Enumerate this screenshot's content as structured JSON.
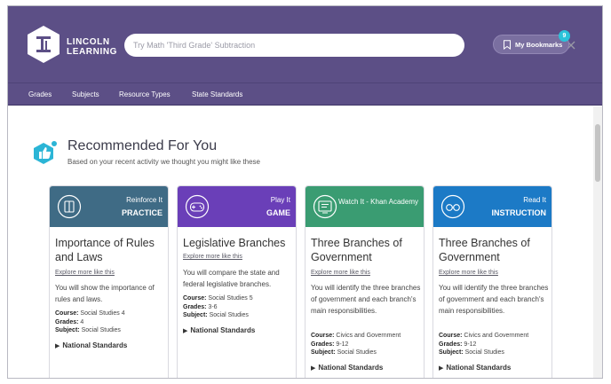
{
  "header": {
    "logo_line1": "LINCOLN",
    "logo_line2": "LEARNING",
    "search_placeholder": "Try Math 'Third Grade' Subtraction",
    "bookmarks_label": "My Bookmarks",
    "bookmarks_count": "9"
  },
  "nav": {
    "items": [
      "Grades",
      "Subjects",
      "Resource Types",
      "State Standards"
    ]
  },
  "recommended": {
    "title": "Recommended For You",
    "subtitle": "Based on your recent activity we thought you might like these"
  },
  "cards": [
    {
      "type_line1": "Reinforce It",
      "type_line2": "PRACTICE",
      "color": "#3f6b85",
      "icon": "practice-icon",
      "title": "Importance of Rules and Laws",
      "explore": "Explore more like this",
      "description": "You will show the importance of rules and laws.",
      "course_label": "Course:",
      "course": "Social Studies 4",
      "grades_label": "Grades:",
      "grades": "4",
      "subject_label": "Subject:",
      "subject": "Social Studies",
      "standards": "National Standards"
    },
    {
      "type_line1": "Play It",
      "type_line2": "GAME",
      "color": "#6a3fb8",
      "icon": "gamepad-icon",
      "title": "Legislative Branches",
      "explore": "Explore more like this",
      "description": "You will compare the state and federal legislative branches.",
      "course_label": "Course:",
      "course": "Social Studies 5",
      "grades_label": "Grades:",
      "grades": "3-6",
      "subject_label": "Subject:",
      "subject": "Social Studies",
      "standards": "National Standards"
    },
    {
      "type_line1": "Watch It - Khan Academy",
      "type_line2": "",
      "color": "#3a9c72",
      "icon": "video-lesson-icon",
      "title": "Three Branches of Government",
      "explore": "Explore more like this",
      "description": "You will identify the three branches of government and each branch's main responsibilities.",
      "course_label": "Course:",
      "course": "Civics and Government",
      "grades_label": "Grades:",
      "grades": "9-12",
      "subject_label": "Subject:",
      "subject": "Social Studies",
      "standards": "National Standards"
    },
    {
      "type_line1": "Read It",
      "type_line2": "INSTRUCTION",
      "color": "#1c7ac6",
      "icon": "glasses-icon",
      "title": "Three Branches of Government",
      "explore": "Explore more like this",
      "description": "You will identify the three branches of government and each branch's main responsibilities.",
      "course_label": "Course:",
      "course": "Civics and Government",
      "grades_label": "Grades:",
      "grades": "9-12",
      "subject_label": "Subject:",
      "subject": "Social Studies",
      "standards": "National Standards"
    }
  ],
  "colors": {
    "header_bg": "#5c4f86",
    "badge": "#2bc3d9"
  }
}
